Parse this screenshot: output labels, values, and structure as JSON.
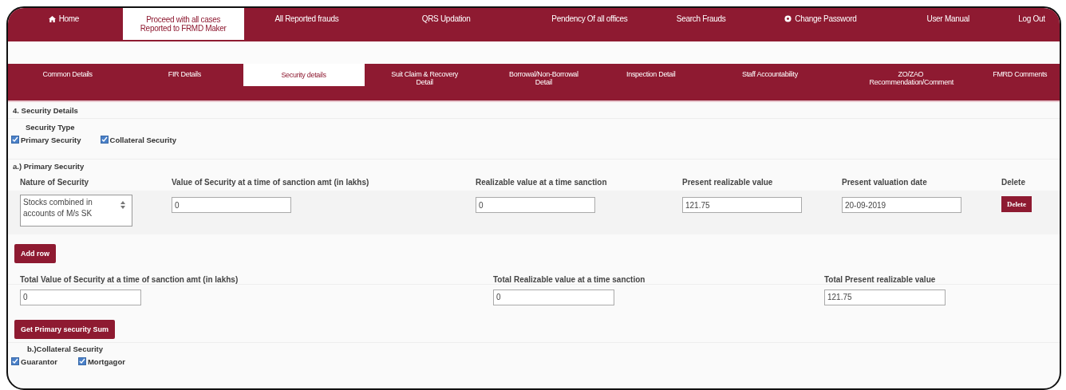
{
  "top_nav": [
    {
      "label": "Home",
      "kind": "home",
      "selected": false
    },
    {
      "label": "Proceed with all cases Reported to FRMD Maker",
      "selected": true
    },
    {
      "label": "All Reported frauds",
      "selected": false
    },
    {
      "label": "QRS Updation",
      "selected": false
    },
    {
      "label": "Pendency Of all offices",
      "selected": false
    },
    {
      "label": "Search Frauds",
      "selected": false
    },
    {
      "label": "Change Password",
      "kind": "settings",
      "selected": false
    },
    {
      "label": "User Manual",
      "selected": false
    },
    {
      "label": "Log Out",
      "selected": false
    }
  ],
  "sub_tabs": [
    {
      "label": "Common Details",
      "selected": false
    },
    {
      "label": "FIR Details",
      "selected": false
    },
    {
      "label": "Security details",
      "selected": true
    },
    {
      "label": "Suit Claim & Recovery Detail",
      "selected": false
    },
    {
      "label": "Borrowal/Non-Borrowal Detail",
      "selected": false
    },
    {
      "label": "Inspection Detail",
      "selected": false
    },
    {
      "label": "Staff Accountability",
      "selected": false
    },
    {
      "label": "ZO/ZAO Recommendation/Comment",
      "selected": false
    },
    {
      "label": "FMRD Comments",
      "selected": false
    }
  ],
  "section_title": "4. Security Details",
  "security_type": {
    "label": "Security Type",
    "options": [
      {
        "label": "Primary Security",
        "checked": true
      },
      {
        "label": "Collateral Security",
        "checked": true
      }
    ]
  },
  "primary_security": {
    "title": "a.) Primary Security",
    "columns": [
      "Nature of Security",
      "Value of Security at a time of sanction amt (in lakhs)",
      "Realizable value at a time sanction",
      "Present realizable value",
      "Present valuation date",
      "Delete"
    ],
    "rows": [
      {
        "nature": "Stocks combined in accounts of M/s SK",
        "value_at_sanction": "0",
        "realizable_value": "0",
        "present_value": "121.75",
        "valuation_date": "20-09-2019",
        "delete_button": "Delete"
      }
    ],
    "add_row_button": "Add row",
    "totals": [
      {
        "label": "Total Value of Security at a time of sanction amt (in lakhs)",
        "value": "0"
      },
      {
        "label": "Total Realizable value at a time sanction",
        "value": "0"
      },
      {
        "label": "Total Present realizable value",
        "value": "121.75"
      }
    ],
    "sum_button": "Get Primary security Sum"
  },
  "collateral_security": {
    "title": "b.)Collateral Security",
    "options": [
      {
        "label": "Guarantor",
        "checked": true
      },
      {
        "label": "Mortgagor",
        "checked": true
      }
    ]
  }
}
